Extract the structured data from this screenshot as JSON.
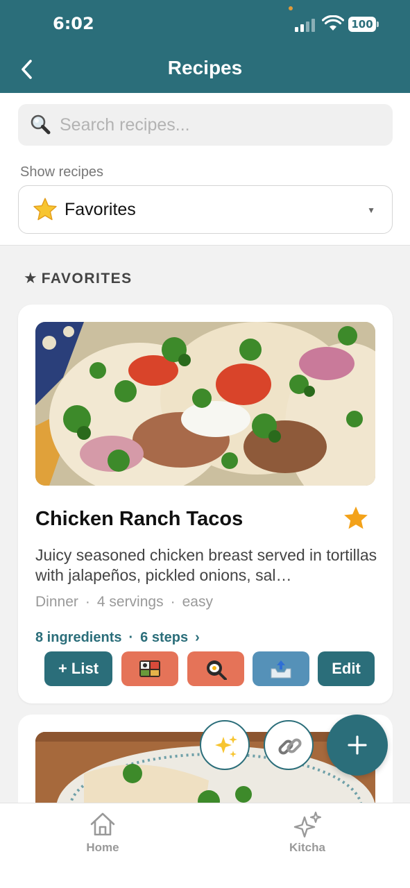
{
  "status_bar": {
    "time": "6:02",
    "battery": "100"
  },
  "header": {
    "title": "Recipes",
    "back_icon": "chevron-left-icon",
    "background_color": "#2b6e7a"
  },
  "search": {
    "icon": "magnifier-icon",
    "placeholder": "Search recipes..."
  },
  "filter": {
    "label": "Show recipes",
    "selected_icon": "star-icon",
    "selected": "Favorites"
  },
  "section": {
    "heading": "FAVORITES",
    "icon": "star-icon"
  },
  "recipe_card": {
    "title": "Chicken Ranch Tacos",
    "favorite": true,
    "description": "Juicy seasoned chicken breast served in tortillas with jalapeños, pickled onions, sal…",
    "category": "Dinner",
    "servings": "4 servings",
    "difficulty": "easy",
    "separator": "·",
    "ingredients_link": "8 ingredients",
    "steps_link": "6 steps",
    "links_arrow": "›",
    "buttons": {
      "list": "+ List",
      "bento_icon": "bento-box-icon",
      "cook_icon": "frying-pan-egg-icon",
      "share_icon": "outbox-tray-icon",
      "edit": "Edit"
    },
    "accent_colors": {
      "primary": "#2b6e7a",
      "coral": "#e57358",
      "blue": "#5591b8",
      "star": "#f3a21a"
    }
  },
  "floating_actions": {
    "sparkle_icon": "sparkles-icon",
    "link_icon": "link-icon",
    "add_icon": "plus-icon"
  },
  "bottom_nav": {
    "items": [
      {
        "label": "Home",
        "icon": "house-icon"
      },
      {
        "label": "Kitcha",
        "icon": "sparkle-stars-icon"
      }
    ]
  }
}
